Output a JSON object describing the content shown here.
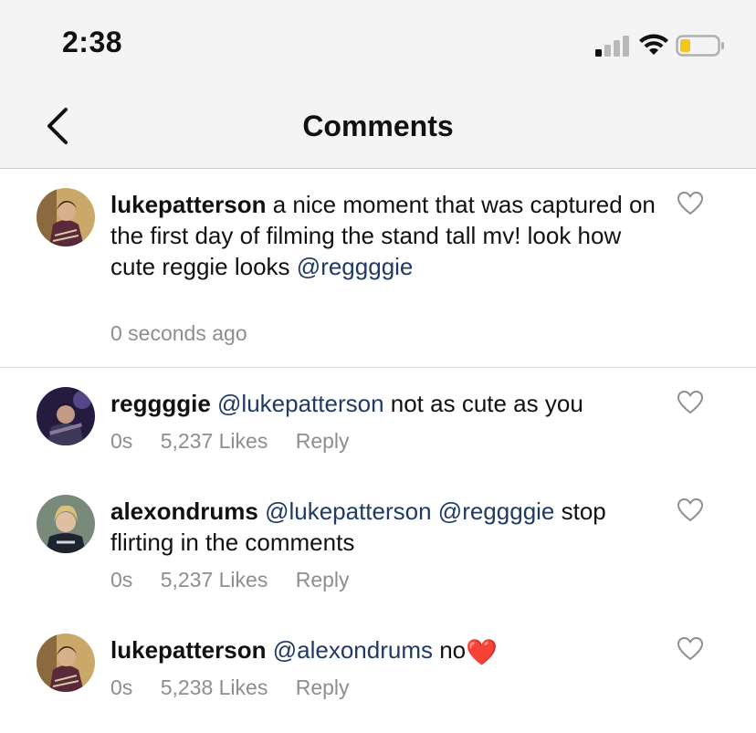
{
  "status_bar": {
    "time": "2:38"
  },
  "nav": {
    "title": "Comments"
  },
  "comments": [
    {
      "username": "lukepatterson",
      "text": "a nice moment that was captured on the first day of filming the stand tall mv! look how cute reggie looks",
      "mention": "@reggggie",
      "timestamp": "0 seconds ago"
    },
    {
      "username": "reggggie",
      "mention": "@lukepatterson",
      "text": "not as cute as you",
      "timestamp": "0s",
      "likes": "5,237 Likes",
      "reply": "Reply"
    },
    {
      "username": "alexondrums",
      "mention1": "@lukepatterson",
      "mention2": "@reggggie",
      "text": "stop flirting in the comments",
      "timestamp": "0s",
      "likes": "5,237 Likes",
      "reply": "Reply"
    },
    {
      "username": "lukepatterson",
      "mention": "@alexondrums",
      "text": "no",
      "emoji": "❤️",
      "timestamp": "0s",
      "likes": "5,238 Likes",
      "reply": "Reply"
    }
  ],
  "icons": {
    "back": "chevron-left-icon",
    "like": "heart-outline-icon",
    "signal": "cellular-signal-icon",
    "wifi": "wifi-icon",
    "battery": "battery-low-icon"
  },
  "colors": {
    "mention": "#1f3a64",
    "meta": "#8e8e8e",
    "battery_level": "#f5c518"
  }
}
